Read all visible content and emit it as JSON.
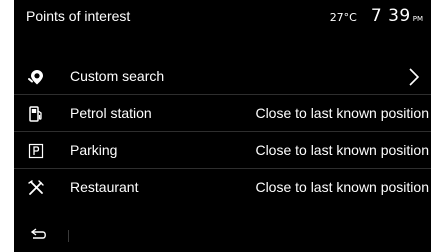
{
  "header": {
    "title": "Points of interest",
    "temperature": "27°C",
    "time": "7 39",
    "ampm": "PM"
  },
  "items": [
    {
      "icon": "custom-search-pin-icon",
      "label": "Custom search",
      "detail": ""
    },
    {
      "icon": "fuel-pump-icon",
      "label": "Petrol station",
      "detail": "Close to last known position"
    },
    {
      "icon": "parking-icon",
      "label": "Parking",
      "detail": "Close to last known position"
    },
    {
      "icon": "fork-knife-icon",
      "label": "Restaurant",
      "detail": "Close to last known position"
    }
  ],
  "footer": {
    "back_icon": "back-arrow-icon"
  },
  "colors": {
    "background": "#000000",
    "text": "#ffffff",
    "divider": "#2e2e2e"
  }
}
